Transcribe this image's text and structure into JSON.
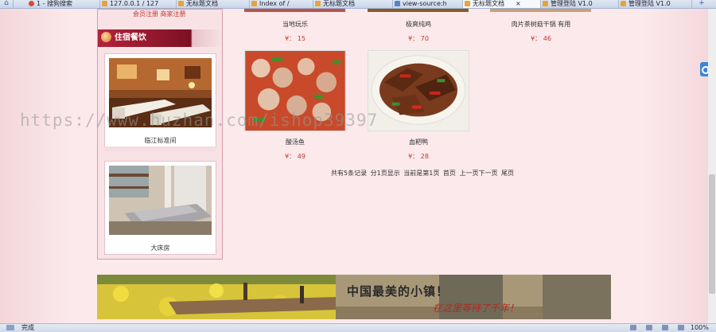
{
  "browser": {
    "tabs": [
      {
        "label": "1 - 搜狗搜索"
      },
      {
        "label": "127.0.0.1 / 127"
      },
      {
        "label": "无标题文档"
      },
      {
        "label": "Index of /"
      },
      {
        "label": "无标题文档"
      },
      {
        "label": "view-source:h"
      },
      {
        "label": "无标题文档"
      },
      {
        "label": "管理登陆 V1.0"
      },
      {
        "label": "管理登陆 V1.0"
      }
    ],
    "icons": {
      "home": "home-icon",
      "new_tab": "plus-icon",
      "tab_close": "close-icon"
    },
    "status": {
      "text": "完成",
      "zoom": "100%"
    }
  },
  "sidebar": {
    "register_links": "会员注册  商家注册",
    "section_title": "住宿餐饮",
    "rooms": [
      {
        "caption": "临江标准间"
      },
      {
        "caption": "大床房"
      }
    ]
  },
  "menu": {
    "top_row": [
      {
        "name": "当地玩乐",
        "price": "¥： 15"
      },
      {
        "name": "极爽纯鸡",
        "price": "¥： 70"
      },
      {
        "name": "肉片茶树菇干锅 有用",
        "price": "¥： 46"
      }
    ],
    "dishes": [
      {
        "name": "酸汤鱼",
        "price": "¥： 49"
      },
      {
        "name": "血粑鸭",
        "price": "¥： 28"
      }
    ],
    "pager": "共有5条记录  分1页显示  当前是第1页 首页 上一页下一页 尾页"
  },
  "banner": {
    "title": "中国最美的小镇！",
    "subtitle": "在这里等待了千年！"
  },
  "watermark": "https://www.huzhan.com/ishop39397",
  "colors": {
    "accent": "#a01c33",
    "price": "#c0392b",
    "page_bg": "#fbe9ec"
  }
}
